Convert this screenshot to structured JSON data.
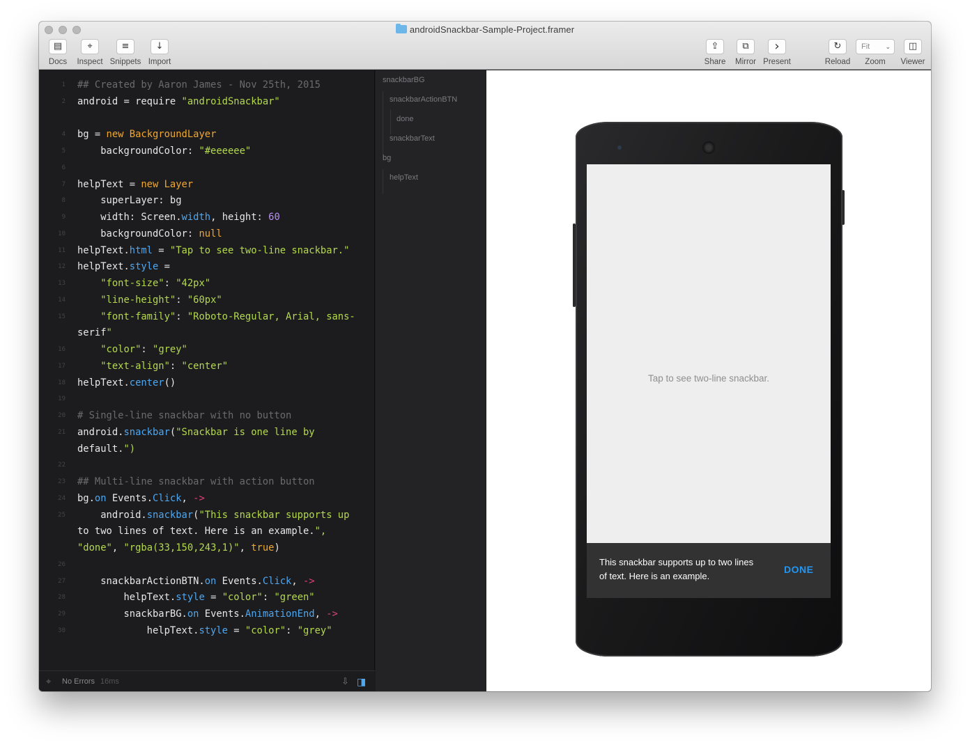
{
  "window": {
    "title": "androidSnackbar-Sample-Project.framer"
  },
  "toolbar": {
    "left": [
      {
        "label": "Docs",
        "icon": "book-icon",
        "glyph": "▤"
      },
      {
        "label": "Inspect",
        "icon": "crosshair-icon",
        "glyph": "⌖"
      },
      {
        "label": "Snippets",
        "icon": "list-icon",
        "glyph": "≡"
      },
      {
        "label": "Import",
        "icon": "download-arrow-icon",
        "glyph": "↓"
      }
    ],
    "right": [
      {
        "label": "Share",
        "icon": "share-icon",
        "glyph": "⇪"
      },
      {
        "label": "Mirror",
        "icon": "mirror-icon",
        "glyph": "⧉"
      },
      {
        "label": "Present",
        "icon": "chevron-right-icon",
        "glyph": "›"
      },
      {
        "label": "Reload",
        "icon": "reload-icon",
        "glyph": "↻"
      },
      {
        "label": "Zoom",
        "icon": "zoom-icon",
        "glyph": ""
      },
      {
        "label": "Viewer",
        "icon": "viewer-icon",
        "glyph": "◫"
      }
    ],
    "zoom_value": "Fit"
  },
  "editor": {
    "lines": [
      {
        "n": "1",
        "code": "## Created by Aaron James - Nov 25th, 2015"
      },
      {
        "n": "2",
        "code": "android = require \"androidSnackbar\""
      },
      {
        "n": "",
        "code": ""
      },
      {
        "n": "4",
        "code": "bg = new BackgroundLayer"
      },
      {
        "n": "5",
        "code": "    backgroundColor: \"#eeeeee\""
      },
      {
        "n": "6",
        "code": ""
      },
      {
        "n": "7",
        "code": "helpText = new Layer"
      },
      {
        "n": "8",
        "code": "    superLayer: bg"
      },
      {
        "n": "9",
        "code": "    width: Screen.width, height: 60"
      },
      {
        "n": "10",
        "code": "    backgroundColor: null"
      },
      {
        "n": "11",
        "code": "helpText.html = \"Tap to see two-line snackbar.\""
      },
      {
        "n": "12",
        "code": "helpText.style ="
      },
      {
        "n": "13",
        "code": "    \"font-size\": \"42px\""
      },
      {
        "n": "14",
        "code": "    \"line-height\": \"60px\""
      },
      {
        "n": "15",
        "code": "    \"font-family\": \"Roboto-Regular, Arial, sans-"
      },
      {
        "n": "",
        "code": "serif\""
      },
      {
        "n": "16",
        "code": "    \"color\": \"grey\""
      },
      {
        "n": "17",
        "code": "    \"text-align\": \"center\""
      },
      {
        "n": "18",
        "code": "helpText.center()"
      },
      {
        "n": "19",
        "code": ""
      },
      {
        "n": "20",
        "code": "# Single-line snackbar with no button"
      },
      {
        "n": "21",
        "code": "android.snackbar(\"Snackbar is one line by"
      },
      {
        "n": "",
        "code": "default.\")"
      },
      {
        "n": "22",
        "code": ""
      },
      {
        "n": "23",
        "code": "## Multi-line snackbar with action button"
      },
      {
        "n": "24",
        "code": "bg.on Events.Click, ->"
      },
      {
        "n": "25",
        "code": "    android.snackbar(\"This snackbar supports up"
      },
      {
        "n": "",
        "code": "to two lines of text. Here is an example.\","
      },
      {
        "n": "",
        "code": "\"done\", \"rgba(33,150,243,1)\", true)"
      },
      {
        "n": "26",
        "code": ""
      },
      {
        "n": "27",
        "code": "    snackbarActionBTN.on Events.Click, ->"
      },
      {
        "n": "28",
        "code": "        helpText.style = \"color\": \"green\""
      },
      {
        "n": "29",
        "code": "        snackbarBG.on Events.AnimationEnd, ->"
      },
      {
        "n": "30",
        "code": "            helpText.style = \"color\": \"grey\""
      }
    ]
  },
  "status": {
    "text": "No Errors",
    "time": "16ms"
  },
  "layers": {
    "items": [
      {
        "label": "snackbarBG",
        "depth": 0
      },
      {
        "label": "snackbarActionBTN",
        "depth": 1
      },
      {
        "label": "done",
        "depth": 2
      },
      {
        "label": "snackbarText",
        "depth": 1
      },
      {
        "label": "bg",
        "depth": 0
      },
      {
        "label": "helpText",
        "depth": 1
      }
    ]
  },
  "preview": {
    "help_text": "Tap to see two-line snackbar.",
    "snackbar_text": "This snackbar supports up to two lines of text. Here is an example.",
    "snackbar_action": "DONE",
    "action_color": "#2196f3",
    "screen_bg": "#eeeeee"
  },
  "colors": {
    "comment": "#6b6b6f",
    "keyword": "#f0a830",
    "string": "#b4d94f",
    "property": "#4fa7f0",
    "number": "#b88ef5",
    "operator": "#e0427a"
  }
}
